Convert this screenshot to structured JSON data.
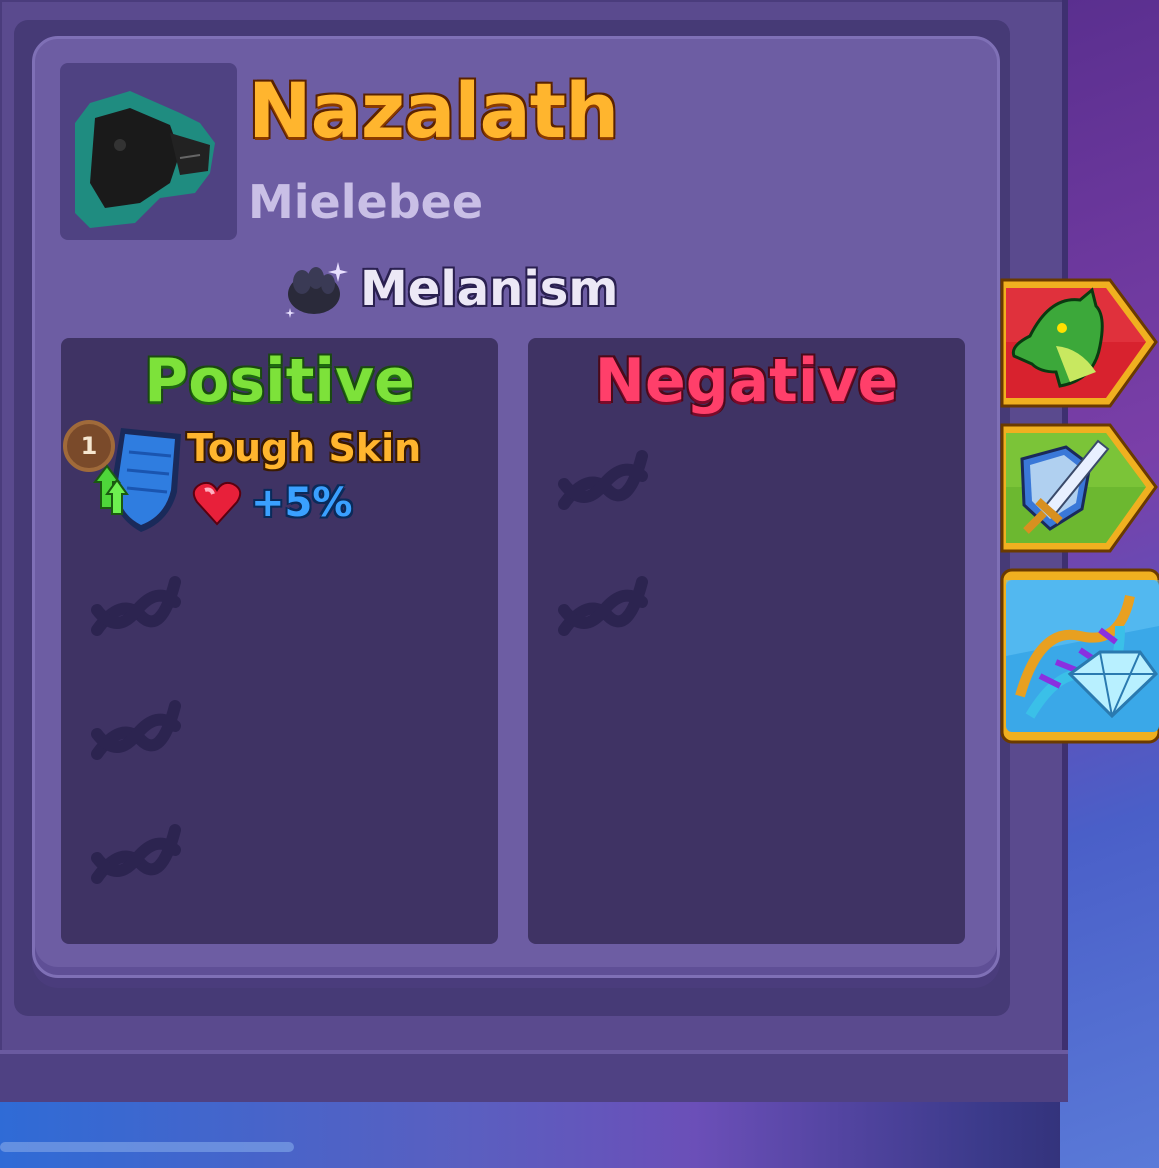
{
  "creature": {
    "name": "Nazalath",
    "species": "Mielebee",
    "mutation": "Melanism"
  },
  "traits": {
    "positive": {
      "heading": "Positive",
      "items": [
        {
          "level": "1",
          "name": "Tough Skin",
          "stat": "+5%",
          "stat_icon": "heart-icon",
          "icon": "shield-icon"
        }
      ],
      "empty_slots": 3
    },
    "negative": {
      "heading": "Negative",
      "items": [],
      "empty_slots": 2
    }
  },
  "side_tabs": [
    {
      "icon": "dragon-head-icon",
      "color": "#d8222e"
    },
    {
      "icon": "sword-shield-icon",
      "color": "#7dc23a"
    },
    {
      "icon": "dna-gem-icon",
      "color": "#3aa8e8"
    }
  ],
  "colors": {
    "title": "#ffb52e",
    "positive": "#7de23a",
    "negative": "#ff3f6a",
    "stat": "#3aa0ff"
  }
}
